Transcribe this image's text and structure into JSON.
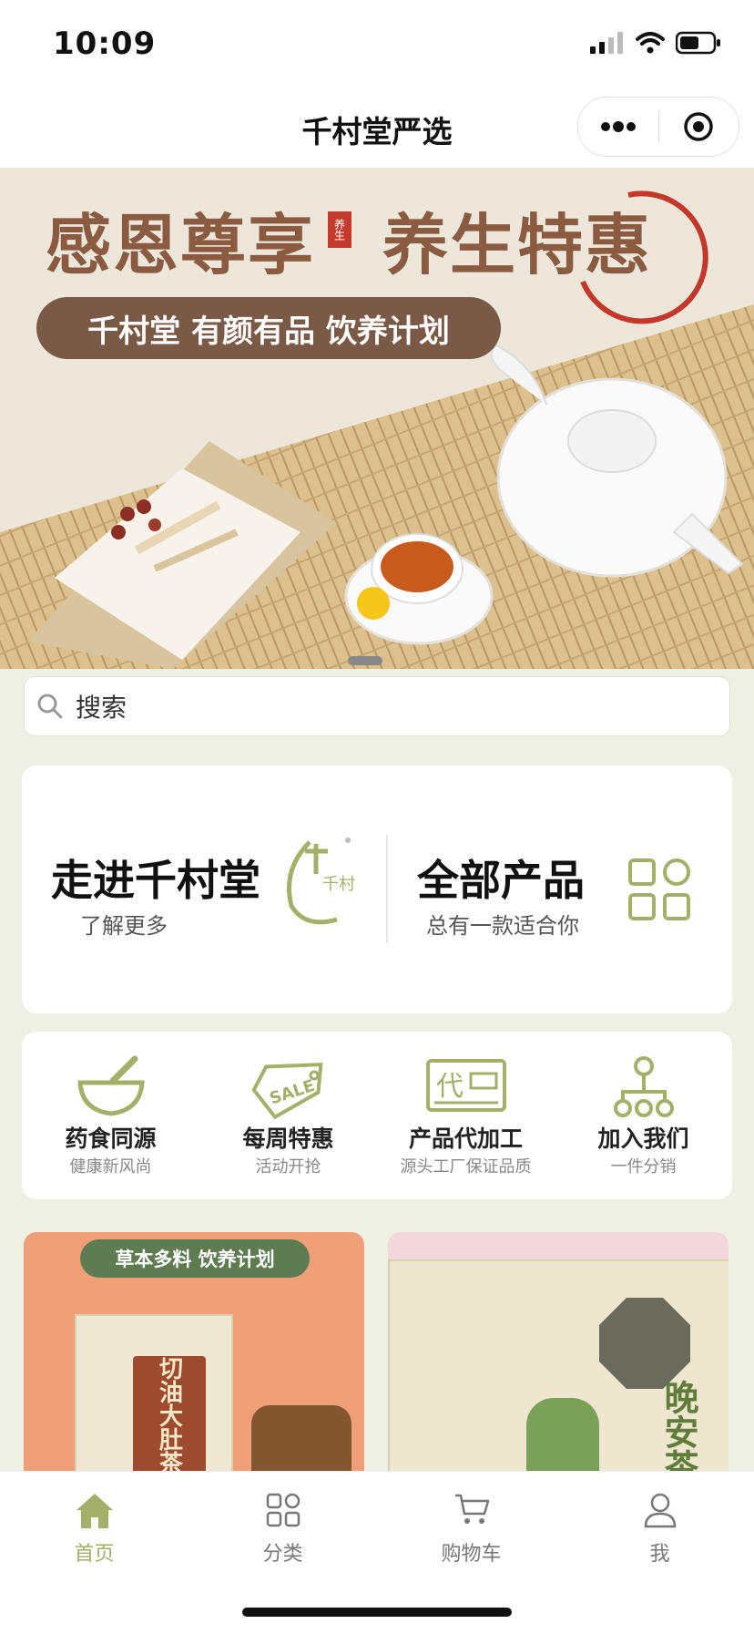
{
  "status_bar": {
    "time": "10:09"
  },
  "nav": {
    "title": "千村堂严选"
  },
  "banner": {
    "slogan_left": "感恩尊享",
    "slogan_right": "养生特惠",
    "seal": "养生",
    "ribbon": "千村堂 有颜有品 饮养计划"
  },
  "search": {
    "placeholder": "搜索"
  },
  "intro": {
    "left_title": "走进千村堂",
    "left_sub": "了解更多",
    "logo_text": "千村堂",
    "right_title": "全部产品",
    "right_sub": "总有一款适合你"
  },
  "features": [
    {
      "title": "药食同源",
      "sub": "健康新风尚",
      "icon": "mortar-pestle-icon"
    },
    {
      "title": "每周特惠",
      "sub": "活动开抢",
      "icon": "sale-tag-icon",
      "icon_text": "SALE"
    },
    {
      "title": "产品代加工",
      "sub": "源头工厂保证品质",
      "icon": "processing-card-icon",
      "icon_text": "代"
    },
    {
      "title": "加入我们",
      "sub": "一件分销",
      "icon": "network-icon"
    }
  ],
  "products": [
    {
      "ribbon": "草本多料 饮养计划",
      "box_label": "切油大肚茶"
    },
    {
      "box_label": "晚安茶"
    }
  ],
  "tabbar": {
    "items": [
      {
        "label": "首页",
        "active": true
      },
      {
        "label": "分类",
        "active": false
      },
      {
        "label": "购物车",
        "active": false
      },
      {
        "label": "我",
        "active": false
      }
    ]
  },
  "colors": {
    "accent": "#a4b06a",
    "inactive": "#777777",
    "bg": "#eef0e4",
    "brown": "#8a5b40"
  }
}
